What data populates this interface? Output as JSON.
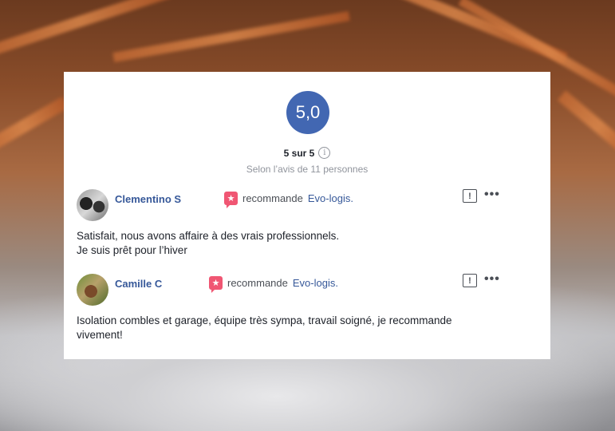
{
  "summary": {
    "score": "5,0",
    "out_of": "5 sur 5",
    "based_on": "Selon l’avis de 11 personnes",
    "info_icon": "i"
  },
  "reviews": [
    {
      "name": "Clementino S",
      "recommends": "recommande",
      "page": "Evo-logis.",
      "text_lines": [
        "Satisfait, nous avons affaire à des vrais professionnels.",
        "Je suis prêt pour l’hiver"
      ]
    },
    {
      "name": "Camille C",
      "recommends": "recommande",
      "page": "Evo-logis.",
      "text_lines": [
        "Isolation combles et garage, équipe très sympa, travail soigné, je recommande",
        "vivement!"
      ]
    }
  ],
  "colors": {
    "accent": "#4267b2",
    "link": "#365899",
    "recommend_badge": "#f05673"
  },
  "icons": {
    "recommend": "star-badge-icon",
    "report": "report-icon",
    "more": "more-icon"
  }
}
